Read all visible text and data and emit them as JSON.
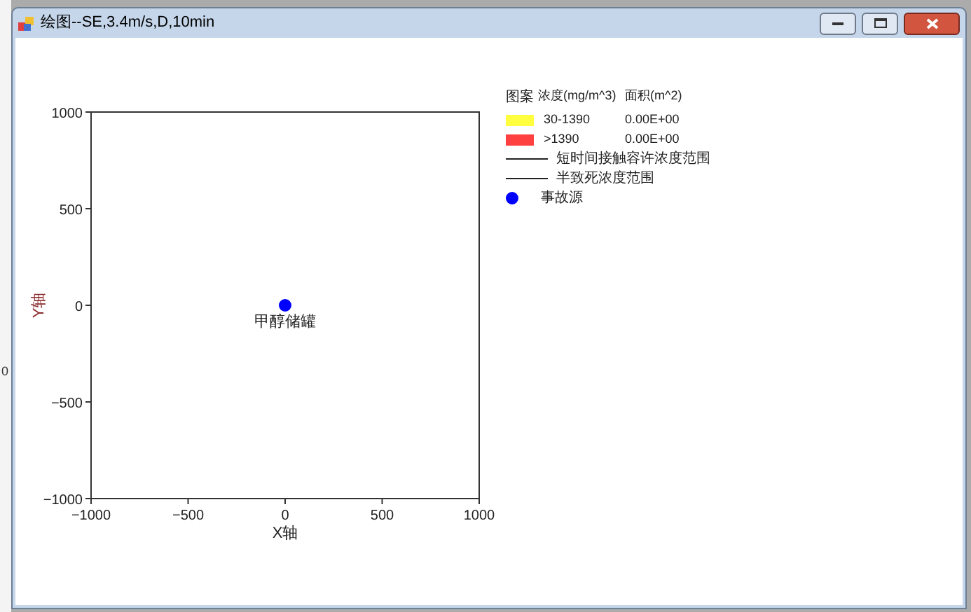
{
  "background_text": "0",
  "window": {
    "title": "绘图--SE,3.4m/s,D,10min"
  },
  "chart_data": {
    "type": "scatter",
    "xlabel": "X轴",
    "ylabel": "Y轴",
    "x": [
      0
    ],
    "series": [
      {
        "name": "事故源",
        "color": "#0000ff",
        "values": [
          0
        ]
      }
    ],
    "xlim": [
      -1000,
      1000
    ],
    "ylim": [
      -1000,
      1000
    ],
    "xticks": [
      -1000,
      -500,
      0,
      500,
      1000
    ],
    "yticks": [
      -1000,
      -500,
      0,
      500,
      1000
    ],
    "annotations": [
      {
        "x": 0,
        "y": 0,
        "text": "甲醇储罐"
      }
    ]
  },
  "legend": {
    "columns": [
      "图案",
      "浓度(mg/m^3)",
      "面积(m^2)"
    ],
    "items": [
      {
        "kind": "swatch",
        "color": "#ffff40",
        "label": "30-1390",
        "area": "0.00E+00"
      },
      {
        "kind": "swatch",
        "color": "#ff4040",
        "label": ">1390",
        "area": "0.00E+00"
      },
      {
        "kind": "line",
        "label": "短时间接触容许浓度范围"
      },
      {
        "kind": "line",
        "label": "半致死浓度范围"
      },
      {
        "kind": "dot",
        "color": "#0000ff"
      }
    ]
  }
}
